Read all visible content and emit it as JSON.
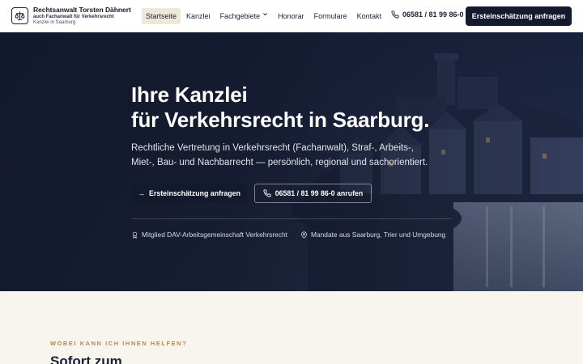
{
  "header": {
    "brand_name": "Rechtsanwalt Torsten Dähnert",
    "brand_sub": "auch Fachanwalt für Verkehrsrecht",
    "brand_location": "Kanzlei in Saarburg",
    "nav": [
      {
        "label": "Startseite",
        "active": true
      },
      {
        "label": "Kanzlei",
        "active": false
      },
      {
        "label": "Fachgebiete",
        "active": false,
        "dropdown": true
      },
      {
        "label": "Honorar",
        "active": false
      },
      {
        "label": "Formulare",
        "active": false
      },
      {
        "label": "Kontakt",
        "active": false
      }
    ],
    "phone": "06581 / 81 99 86-0",
    "cta": "Ersteinschätzung anfragen"
  },
  "hero": {
    "title_line1": "Ihre Kanzlei",
    "title_line2": "für Verkehrsrecht in Saarburg.",
    "text_line1": "Rechtliche Vertretung in Verkehrsrecht (Fachanwalt), Straf-, Arbeits-,",
    "text_line2": "Miet-, Bau- und Nachbarrecht — persönlich, regional und sachorientiert.",
    "primary_button": "Ersteinschätzung anfragen",
    "secondary_button": "06581 / 81 99 86-0 anrufen",
    "badge_membership": "Mitglied DAV-Arbeitsgemeinschaft Verkehrsrecht",
    "badge_region": "Mandate aus Saarburg, Trier und Umgebung"
  },
  "section": {
    "eyebrow": "WOBEI KANN ICH IHNEN HELFEN?",
    "title": "Sofort zum"
  },
  "colors": {
    "navy": "#141a2e",
    "accent_gold": "#b08a4e",
    "cream": "#f8f4ee",
    "nav_active_bg": "#efe7da"
  },
  "icons": {
    "logo": "scales-icon",
    "phone": "phone-icon",
    "arrow": "arrow-right-icon",
    "membership": "award-icon",
    "location": "map-pin-icon",
    "dropdown": "chevron-down-icon"
  }
}
